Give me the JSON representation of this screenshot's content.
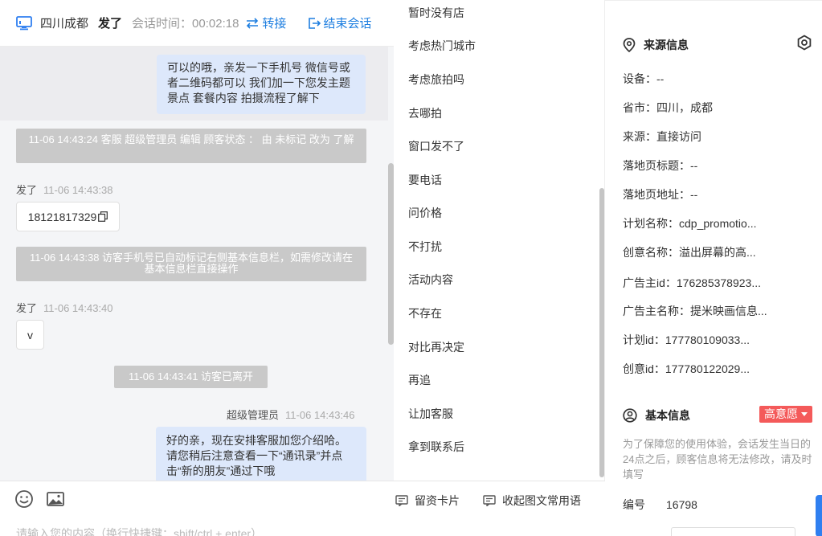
{
  "header": {
    "location": "四川成都",
    "nickname": "发了",
    "session_label": "会话时间：00:02:18",
    "transfer_label": "转接",
    "end_label": "结束会话"
  },
  "messages": {
    "agent_msg_1": "可以的哦，亲发一下手机号 微信号或者二维码都可以 我们加一下您发主题景点 套餐内容 拍摄流程了解下",
    "sys_status": "11-06 14:43:24 客服 超级管理员 编辑 顾客状态 ： 由 未标记 改为 了解",
    "visitor_name_1": "发了",
    "visitor_time_1": "11-06 14:43:38",
    "visitor_msg_1": "18121817329",
    "sys_phone": "11-06 14:43:38 访客手机号已自动标记右侧基本信息栏，如需修改请在基本信息栏直接操作",
    "visitor_name_2": "发了",
    "visitor_time_2": "11-06 14:43:40",
    "visitor_msg_2": "v",
    "sys_left": "11-06 14:43:41 访客已离开",
    "agent_name": "超级管理员",
    "agent_time": "11-06 14:43:46",
    "agent_msg_2": "好的亲，现在安排客服加您介绍哈。请您稍后注意查看一下“通讯录”并点击“新的朋友”通过下哦"
  },
  "composer": {
    "card_label": "留资卡片",
    "collapse_label": "收起图文常用语",
    "placeholder": "请输入您的内容（换行快捷键：shift/ctrl + enter）"
  },
  "phrases": [
    "暂时没有店",
    "考虑热门城市",
    "考虑旅拍吗",
    "去哪拍",
    "窗口发不了",
    "要电话",
    "问价格",
    "不打扰",
    "活动内容",
    "不存在",
    "对比再决定",
    "再追",
    "让加客服",
    "拿到联系后"
  ],
  "source_info": {
    "title": "来源信息",
    "device": "设备：--",
    "region": "省市：四川，成都",
    "source": "来源：直接访问",
    "landing_title": "落地页标题：--",
    "landing_url": "落地页地址：--",
    "plan_name": "计划名称：cdp_promotio...",
    "creative_name": "创意名称：溢出屏幕的高...",
    "advertiser_id": "广告主id：176285378923...",
    "advertiser_name": "广告主名称：提米映画信息...",
    "plan_id": "计划id：177780109033...",
    "creative_id": "创意id：177780122029..."
  },
  "basic_info": {
    "title": "基本信息",
    "intent_badge": "高意愿",
    "notice": "为了保障您的使用体验，会话发生当日的24点之后，顾客信息将无法修改，请及时填写",
    "id_label": "编号",
    "id_value": "16798"
  },
  "colors": {
    "accent": "#1f7fe0",
    "badge": "#f45a5a",
    "agent_bubble": "#dde8fb",
    "system_bubble": "#c9c9c9"
  }
}
